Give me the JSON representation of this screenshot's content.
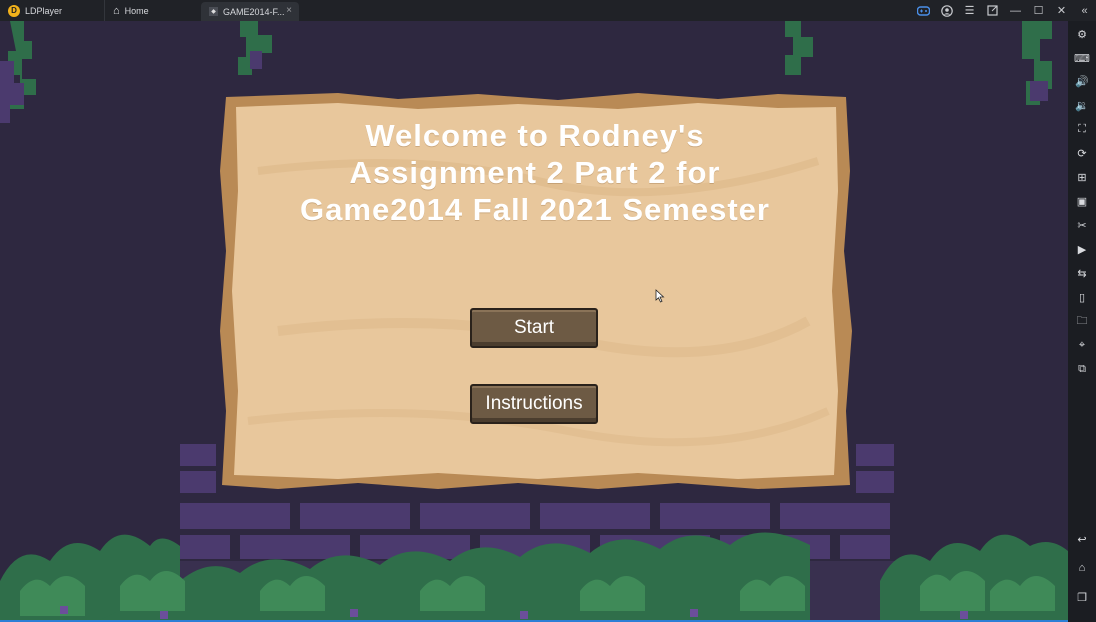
{
  "titlebar": {
    "app_tab": {
      "label": "LDPlayer",
      "logo": "ldplayer-logo-icon"
    },
    "home_tab": {
      "label": "Home",
      "icon": "home-icon"
    },
    "game_tab": {
      "label": "GAME2014-F...",
      "icon": "unity-icon",
      "close": "×"
    }
  },
  "window_controls": [
    "gamepad-icon",
    "account-icon",
    "menu-icon",
    "popout-icon",
    "minimize-icon",
    "maximize-icon",
    "close-icon",
    "collapse-sidebar-icon"
  ],
  "sidebar": {
    "icons": [
      "settings-icon",
      "keyboard-icon",
      "volume-up-icon",
      "volume-down-icon",
      "screenshot-icon",
      "rotate-icon",
      "install-apk-icon",
      "apk-icon",
      "scissors-icon",
      "record-icon",
      "sync-icon",
      "shake-icon",
      "folder-icon",
      "location-icon",
      "multi-instance-icon"
    ],
    "bottom_icons": [
      "back-icon",
      "home-nav-icon",
      "recents-icon"
    ]
  },
  "game": {
    "title": "Welcome to Rodney's Assignment 2 Part 2 for Game2014 Fall 2021 Semester",
    "buttons": {
      "start": "Start",
      "instructions": "Instructions"
    }
  },
  "colors": {
    "background": "#2e2840",
    "parchment": "#e8c79c",
    "parchment_edge": "#b98a55",
    "button": "#6d5a44",
    "brick": "#4b3a6e",
    "vine": "#2f6e4a"
  }
}
